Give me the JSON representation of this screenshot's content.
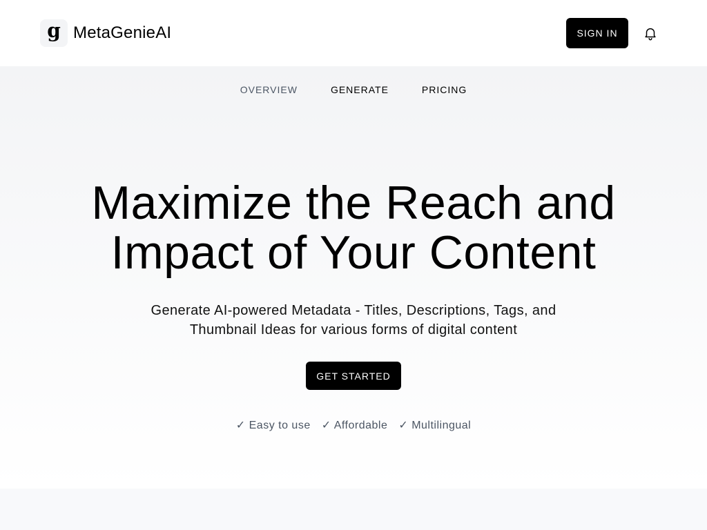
{
  "header": {
    "logo_letter": "g",
    "brand": "MetaGenieAI",
    "signin_label": "SIGN IN",
    "icons": {
      "notifications": "bell-icon"
    }
  },
  "nav": {
    "items": [
      {
        "label": "OVERVIEW"
      },
      {
        "label": "GENERATE"
      },
      {
        "label": "PRICING"
      }
    ]
  },
  "hero": {
    "headline_line1": "Maximize the Reach and",
    "headline_line2": "Impact of Your Content",
    "subtitle_line1": "Generate AI-powered Metadata - Titles, Descriptions, Tags, and",
    "subtitle_line2": "Thumbnail Ideas for various forms of digital content",
    "cta_label": "GET STARTED",
    "features": [
      "✓ Easy to use",
      "✓ Affordable",
      "✓ Multilingual"
    ]
  },
  "colors": {
    "primary": "#000000",
    "muted_text": "#4b5563",
    "hero_gradient_top": "#f3f4f6",
    "hero_gradient_bottom": "#ffffff",
    "logo_badge": "#f3f4f6"
  }
}
